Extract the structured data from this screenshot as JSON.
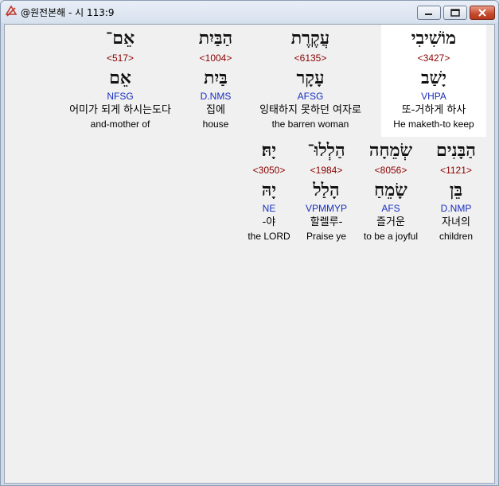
{
  "window": {
    "title": "@원전본해 - 시 113:9",
    "minimize_label": "minimize",
    "maximize_label": "maximize",
    "close_label": "close"
  },
  "colors": {
    "strong_number": "#8b0000",
    "parsing": "#1a2fbf",
    "selected_background": "#ffffff"
  },
  "words": [
    {
      "hebrew": "מוֹשִׁיבִי",
      "strong": "<3427>",
      "lemma": "יָשַׁב",
      "parsing": "VHPA",
      "korean": "또-거하게 하사",
      "english": "He maketh-to keep",
      "selected": true
    },
    {
      "hebrew": "עֲקֶרֶת",
      "strong": "<6135>",
      "lemma": "עָקָר",
      "parsing": "AFSG",
      "korean": "잉태하지 못하던 여자로",
      "english": "the barren woman",
      "selected": false
    },
    {
      "hebrew": "הַבַּיִת",
      "strong": "<1004>",
      "lemma": "בַּיִת",
      "parsing": "D.NMS",
      "korean": "집에",
      "english": "house",
      "selected": false
    },
    {
      "hebrew": "אֵם־",
      "strong": "<517>",
      "lemma": "אֵם",
      "parsing": "NFSG",
      "korean": "어미가 되게 하시는도다",
      "english": "and-mother of",
      "selected": false
    },
    {
      "hebrew": "הַבָּנִים",
      "strong": "<1121>",
      "lemma": "בֵּן",
      "parsing": "D.NMP",
      "korean": "자녀의",
      "english": "children",
      "selected": false
    },
    {
      "hebrew": "שְׂמֵחָה",
      "strong": "<8056>",
      "lemma": "שָׂמֵחַ",
      "parsing": "AFS",
      "korean": "즐거운",
      "english": "to be a joyful",
      "selected": false
    },
    {
      "hebrew": "הַלְלוּ־",
      "strong": "<1984>",
      "lemma": "הָלַל",
      "parsing": "VPMMYP",
      "korean": "할렐루-",
      "english": "Praise ye",
      "selected": false
    },
    {
      "hebrew": "יָהּ׃",
      "strong": "<3050>",
      "lemma": "יָהּ",
      "parsing": "NE",
      "korean": "-야",
      "english": "the LORD",
      "selected": false
    }
  ]
}
